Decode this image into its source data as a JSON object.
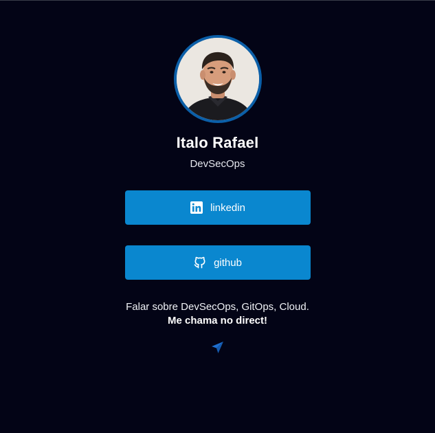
{
  "profile": {
    "name": "Italo Rafael",
    "role": "DevSecOps",
    "avatar_icon": "profile-photo"
  },
  "links": [
    {
      "label": "linkedin",
      "icon": "linkedin-icon"
    },
    {
      "label": "github",
      "icon": "github-icon"
    }
  ],
  "about": {
    "text": "Falar sobre DevSecOps, GitOps, Cloud.",
    "cta": "Me chama no direct!",
    "icon": "send-icon"
  },
  "colors": {
    "background": "#030416",
    "button": "#0a87cf",
    "avatar_border": "#0b5fa8",
    "send_icon": "#1e6fd0"
  }
}
